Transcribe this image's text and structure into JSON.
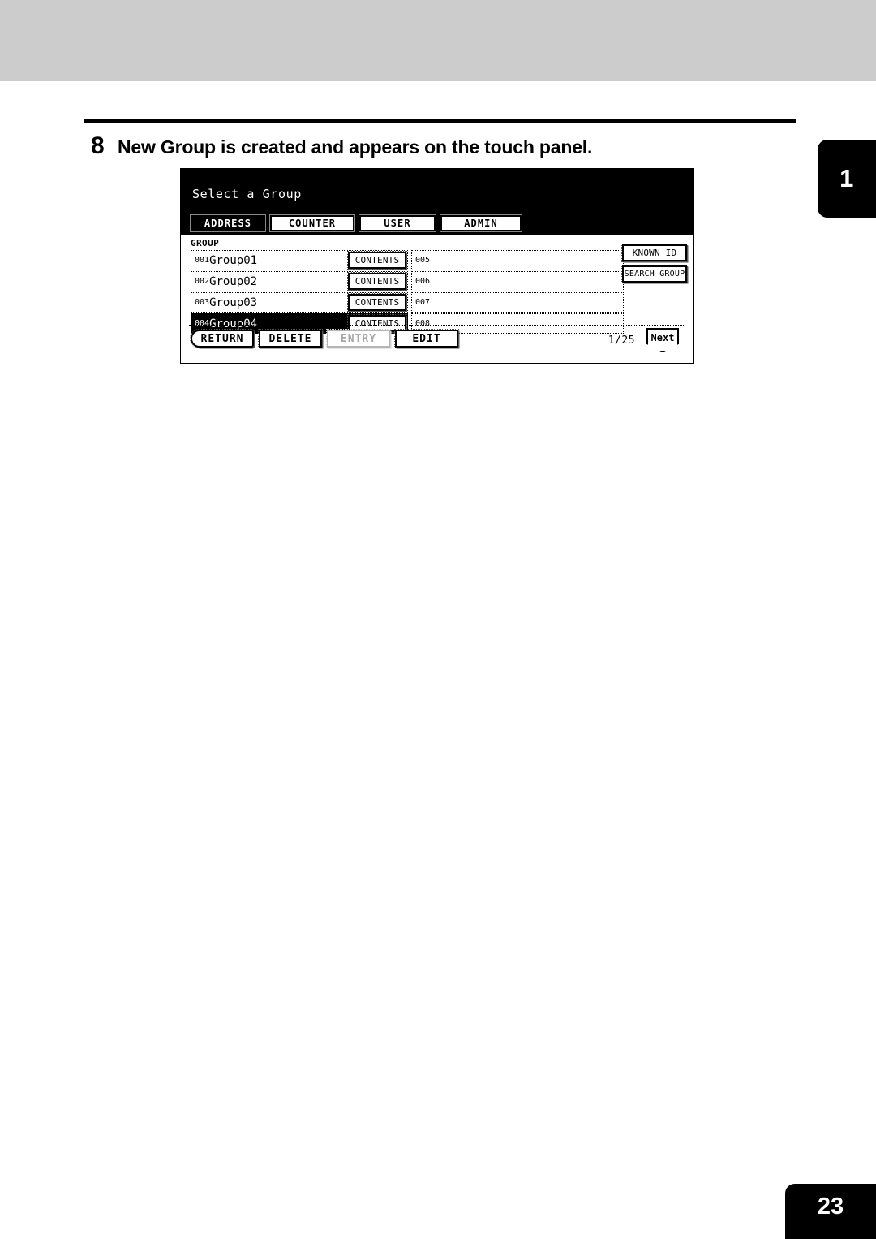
{
  "document": {
    "chapter_tab": "1",
    "page_number": "23",
    "step": {
      "number": "8",
      "text": "New Group is created and appears on the touch panel."
    }
  },
  "panel": {
    "title": "Select a Group",
    "tabs": [
      {
        "label": "ADDRESS",
        "selected": true
      },
      {
        "label": "COUNTER",
        "selected": false
      },
      {
        "label": "USER",
        "selected": false
      },
      {
        "label": "ADMIN",
        "selected": false
      }
    ],
    "group_label": "GROUP",
    "contents_label": "CONTENTS",
    "left_column": [
      {
        "index": "001",
        "name": "Group01",
        "selected": false
      },
      {
        "index": "002",
        "name": "Group02",
        "selected": false
      },
      {
        "index": "003",
        "name": "Group03",
        "selected": false
      },
      {
        "index": "004",
        "name": "Group04",
        "selected": true
      }
    ],
    "right_column": [
      {
        "index": "005",
        "name": ""
      },
      {
        "index": "006",
        "name": ""
      },
      {
        "index": "007",
        "name": ""
      },
      {
        "index": "008",
        "name": ""
      }
    ],
    "side_buttons": {
      "known_id": "KNOWN ID",
      "search_group": "SEARCH GROUP"
    },
    "bottom_buttons": {
      "return": "RETURN",
      "delete": "DELETE",
      "entry": "ENTRY",
      "edit": "EDIT"
    },
    "pagination": {
      "counter": "1/25",
      "next": "Next"
    }
  },
  "colors": {
    "band": "#cccccc",
    "ink": "#000000",
    "paper": "#ffffff",
    "disabled": "#a8a8a8"
  }
}
